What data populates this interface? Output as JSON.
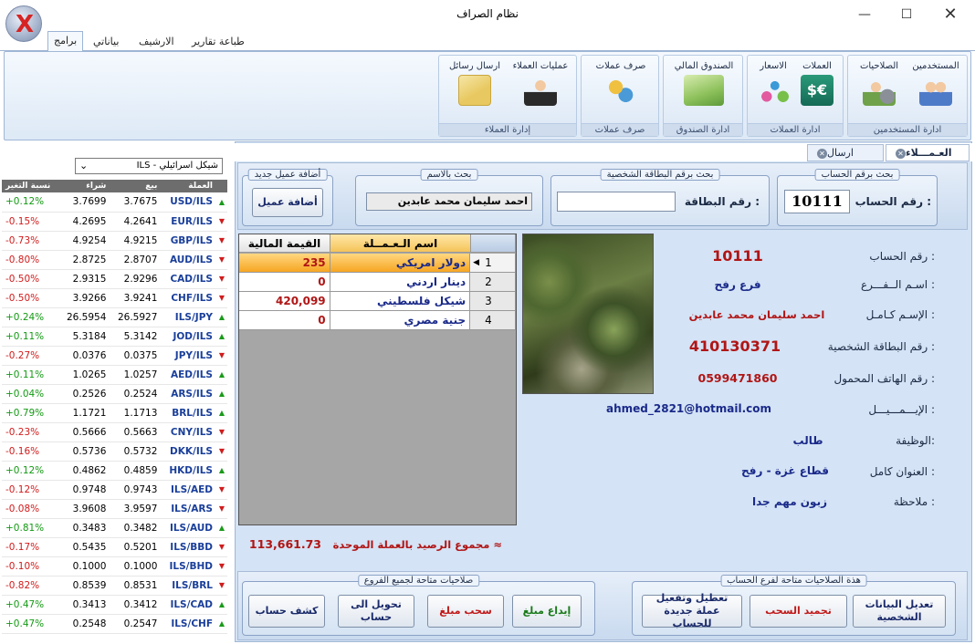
{
  "window": {
    "title": "نظام الصراف"
  },
  "menu_tabs": [
    "برامج",
    "بياناتي",
    "الارشيف",
    "طباعة تقارير"
  ],
  "ribbon": {
    "groups": [
      {
        "label": "ادارة المستخدمين",
        "buttons": [
          "المستخدمين",
          "الصلاحيات"
        ]
      },
      {
        "label": "ادارة العملات",
        "buttons": [
          "العملات",
          "الاسعار"
        ]
      },
      {
        "label": "ادارة الصندوق",
        "buttons": [
          "الصندوق المالي"
        ]
      },
      {
        "label": "صرف عملات",
        "buttons": [
          "صرف عملات"
        ]
      },
      {
        "label": "إدارة العملاء",
        "buttons": [
          "عمليات العملاء",
          "ارسال رسائل"
        ]
      }
    ]
  },
  "currency_panel": {
    "selected": "ILS - شيكل اسرائيلي",
    "headers": {
      "pair": "العملة",
      "sell": "بيع",
      "buy": "شراء",
      "change": "نسبة التغير"
    },
    "rows": [
      {
        "pair": "USD/ILS",
        "sell": "3.7675",
        "buy": "3.7699",
        "change": "+0.12%",
        "dir": "up"
      },
      {
        "pair": "EUR/ILS",
        "sell": "4.2641",
        "buy": "4.2695",
        "change": "-0.15%",
        "dir": "down"
      },
      {
        "pair": "GBP/ILS",
        "sell": "4.9215",
        "buy": "4.9254",
        "change": "-0.73%",
        "dir": "down"
      },
      {
        "pair": "AUD/ILS",
        "sell": "2.8707",
        "buy": "2.8725",
        "change": "-0.80%",
        "dir": "down"
      },
      {
        "pair": "CAD/ILS",
        "sell": "2.9296",
        "buy": "2.9315",
        "change": "-0.50%",
        "dir": "down"
      },
      {
        "pair": "CHF/ILS",
        "sell": "3.9241",
        "buy": "3.9266",
        "change": "-0.50%",
        "dir": "down"
      },
      {
        "pair": "ILS/JPY",
        "sell": "26.5927",
        "buy": "26.5954",
        "change": "+0.24%",
        "dir": "up"
      },
      {
        "pair": "JOD/ILS",
        "sell": "5.3142",
        "buy": "5.3184",
        "change": "+0.11%",
        "dir": "up"
      },
      {
        "pair": "JPY/ILS",
        "sell": "0.0375",
        "buy": "0.0376",
        "change": "-0.27%",
        "dir": "down"
      },
      {
        "pair": "AED/ILS",
        "sell": "1.0257",
        "buy": "1.0265",
        "change": "+0.11%",
        "dir": "up"
      },
      {
        "pair": "ARS/ILS",
        "sell": "0.2524",
        "buy": "0.2526",
        "change": "+0.04%",
        "dir": "up"
      },
      {
        "pair": "BRL/ILS",
        "sell": "1.1713",
        "buy": "1.1721",
        "change": "+0.79%",
        "dir": "up"
      },
      {
        "pair": "CNY/ILS",
        "sell": "0.5663",
        "buy": "0.5666",
        "change": "-0.23%",
        "dir": "down"
      },
      {
        "pair": "DKK/ILS",
        "sell": "0.5732",
        "buy": "0.5736",
        "change": "-0.16%",
        "dir": "down"
      },
      {
        "pair": "HKD/ILS",
        "sell": "0.4859",
        "buy": "0.4862",
        "change": "+0.12%",
        "dir": "up"
      },
      {
        "pair": "ILS/AED",
        "sell": "0.9743",
        "buy": "0.9748",
        "change": "-0.12%",
        "dir": "down"
      },
      {
        "pair": "ILS/ARS",
        "sell": "3.9597",
        "buy": "3.9608",
        "change": "-0.08%",
        "dir": "down"
      },
      {
        "pair": "ILS/AUD",
        "sell": "0.3482",
        "buy": "0.3483",
        "change": "+0.81%",
        "dir": "up"
      },
      {
        "pair": "ILS/BBD",
        "sell": "0.5201",
        "buy": "0.5435",
        "change": "-0.17%",
        "dir": "down"
      },
      {
        "pair": "ILS/BHD",
        "sell": "0.1000",
        "buy": "0.1000",
        "change": "-0.10%",
        "dir": "down"
      },
      {
        "pair": "ILS/BRL",
        "sell": "0.8531",
        "buy": "0.8539",
        "change": "-0.82%",
        "dir": "down"
      },
      {
        "pair": "ILS/CAD",
        "sell": "0.3412",
        "buy": "0.3413",
        "change": "+0.47%",
        "dir": "up"
      },
      {
        "pair": "ILS/CHF",
        "sell": "0.2547",
        "buy": "0.2548",
        "change": "+0.47%",
        "dir": "up"
      }
    ]
  },
  "doc_tabs": [
    "العـمـــلاء",
    "ارسال رسائل"
  ],
  "search": {
    "account": {
      "caption": "بحث برقم الحساب",
      "label": "رقم الحساب :",
      "value": "10111"
    },
    "id_card": {
      "caption": "بحث برقم البطاقة الشخصية",
      "label": "رقم البطاقة :",
      "value": ""
    },
    "name": {
      "caption": "بحث بالاسم",
      "value": "احمد سليمان محمد عابدين"
    },
    "add": {
      "caption": "أضافة عميل جديد",
      "button": "أضافة عميل"
    }
  },
  "balances": {
    "headers": {
      "currency": "اسم الـعـمــلة",
      "amount": "القيمة المالية"
    },
    "rows": [
      {
        "num": "1",
        "currency": "دولار امريكي",
        "amount": "235"
      },
      {
        "num": "2",
        "currency": "دينار اردني",
        "amount": "0"
      },
      {
        "num": "3",
        "currency": "شيكل فلسطيني",
        "amount": "420,099"
      },
      {
        "num": "4",
        "currency": "جنية مصري",
        "amount": "0"
      }
    ],
    "total_label": "مجموع الرصيد بالعملة الموحدة  ≈",
    "total_value": "113,661.73"
  },
  "details": {
    "account_label": "رقم الحساب :",
    "account": "10111",
    "branch_label": "اسـم الــفـــرع :",
    "branch": "فرع رفح",
    "fullname_label": "الإسـم كـامـل :",
    "fullname": "احمد سليمان محمد عابدين",
    "id_label": "رقم البطاقة الشخصية :",
    "id": "410130371",
    "mobile_label": "رقم الهاتف المحمول :",
    "mobile": "0599471860",
    "email_label": "الإيـــمـــيـــل :",
    "email": "ahmed_2821@hotmail.com",
    "job_label": "الوظيفة:",
    "job": "طالب",
    "address_label": "العنوان كامل :",
    "address": "قطاع غزة - رفح",
    "note_label": "ملاحظة :",
    "note": "زبون مهم جدا"
  },
  "actions": {
    "branch_caption": "هذة الصلاحيات متاحة لفرع الحساب",
    "branch_buttons": [
      "تعديل البيانات الشخصية",
      "تجميد السحب",
      "تعطيل وتفعيل عملة جديدة للحساب"
    ],
    "all_caption": "صلاحيات متاحة لجميع الفروع",
    "all_buttons": [
      "إيداع مبلغ",
      "سحب مبلغ",
      "تحويل الى حساب",
      "كشف حساب"
    ]
  }
}
